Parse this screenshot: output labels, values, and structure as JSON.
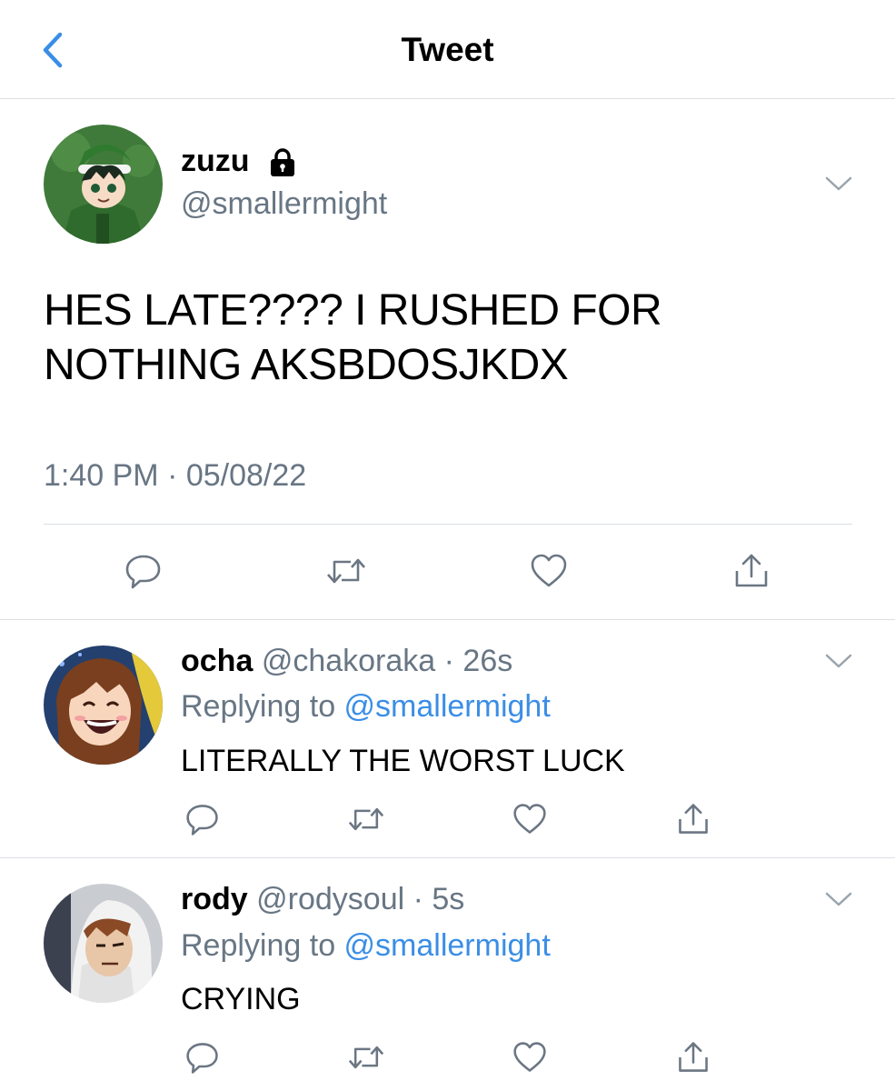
{
  "header": {
    "title": "Tweet",
    "back_icon": "chevron-left-icon"
  },
  "main_tweet": {
    "display_name": "zuzu",
    "handle": "@smallermight",
    "text_line1": "HES LATE???? I RUSHED FOR",
    "text_line2": "NOTHING AKSBDOSJKDX",
    "timestamp": "1:40 PM · 05/08/22",
    "lock_icon": "lock-icon"
  },
  "replies": [
    {
      "display_name": "ocha",
      "handle": "@chakoraka",
      "time": " · 26s",
      "replying_prefix": "Replying to ",
      "replying_to": "@smallermight",
      "text": "LITERALLY THE WORST LUCK"
    },
    {
      "display_name": "rody",
      "handle": "@rodysoul",
      "time": " · 5s",
      "replying_prefix": "Replying to ",
      "replying_to": "@smallermight",
      "text": "CRYING"
    }
  ],
  "actions": [
    "reply-icon",
    "retweet-icon",
    "like-icon",
    "share-icon"
  ],
  "colors": {
    "accent": "#3a8ee6",
    "secondary_text": "#687684",
    "divider": "#dcdfe3",
    "icon": "#6b7683"
  }
}
